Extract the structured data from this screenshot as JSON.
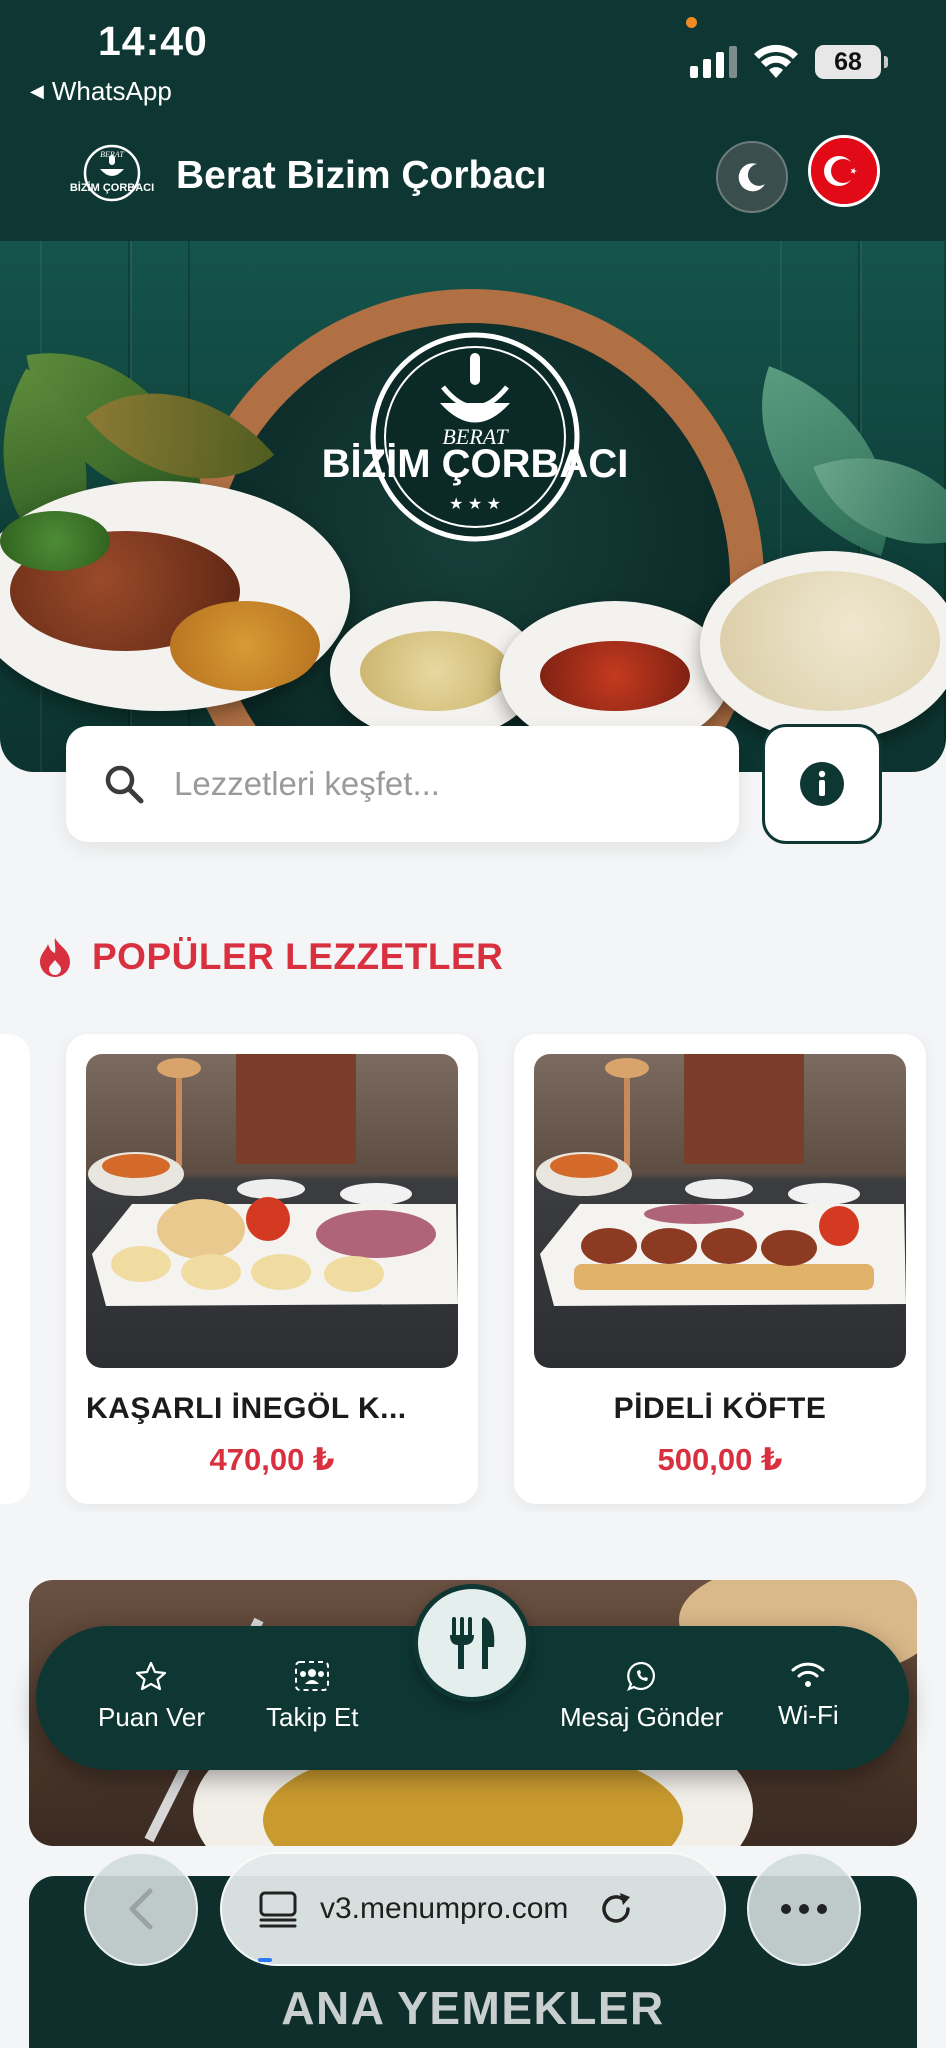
{
  "status_bar": {
    "time": "14:40",
    "back_app": "WhatsApp",
    "battery": "68"
  },
  "header": {
    "logo_text_top": "BERAT",
    "logo_text_main": "BİZİM ÇORBACI",
    "title": "Berat Bizim Çorbacı"
  },
  "search": {
    "placeholder": "Lezzetleri keşfet..."
  },
  "popular": {
    "title": "POPÜLER LEZZETLER",
    "items": [
      {
        "name": "KAŞARLI İNEGÖL K...",
        "price": "470,00 ₺"
      },
      {
        "name": "PİDELİ KÖFTE",
        "price": "500,00 ₺"
      }
    ]
  },
  "action_bar": {
    "rate": "Puan Ver",
    "follow": "Takip Et",
    "message": "Mesaj Gönder",
    "wifi": "Wi-Fi"
  },
  "categories": {
    "main_dishes": "ANA YEMEKLER"
  },
  "browser": {
    "url": "v3.menumpro.com"
  },
  "colors": {
    "brand_dark": "#0e3733",
    "accent_red": "#d9303f"
  }
}
